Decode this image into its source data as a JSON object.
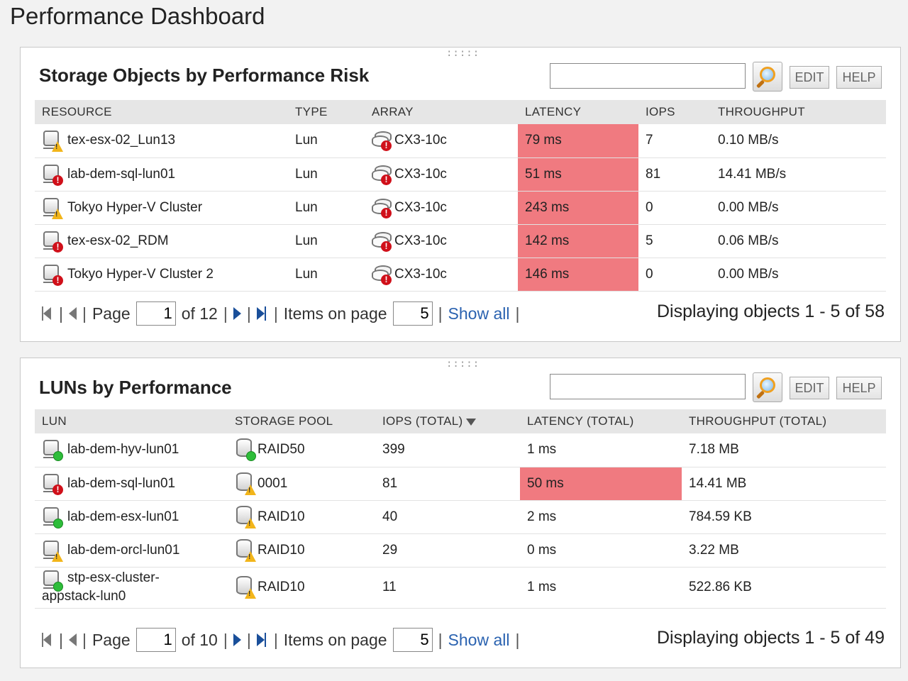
{
  "page": {
    "title": "Performance Dashboard"
  },
  "panel1": {
    "title": "Storage Objects by Performance Risk",
    "grip": ":::::",
    "search": {
      "value": "",
      "placeholder": ""
    },
    "edit_label": "EDIT",
    "help_label": "HELP",
    "columns": [
      "RESOURCE",
      "TYPE",
      "ARRAY",
      "LATENCY",
      "IOPS",
      "THROUGHPUT"
    ],
    "rows": [
      {
        "resource": "tex-esx-02_Lun13",
        "status": "warning",
        "type": "Lun",
        "array": "CX3-10c",
        "latency": "79 ms",
        "iops": "7",
        "throughput": "0.10 MB/s"
      },
      {
        "resource": "lab-dem-sql-lun01",
        "status": "critical",
        "type": "Lun",
        "array": "CX3-10c",
        "latency": "51 ms",
        "iops": "81",
        "throughput": "14.41 MB/s"
      },
      {
        "resource": "Tokyo Hyper-V Cluster",
        "status": "warning",
        "type": "Lun",
        "array": "CX3-10c",
        "latency": "243 ms",
        "iops": "0",
        "throughput": "0.00 MB/s"
      },
      {
        "resource": "tex-esx-02_RDM",
        "status": "critical",
        "type": "Lun",
        "array": "CX3-10c",
        "latency": "142 ms",
        "iops": "5",
        "throughput": "0.06 MB/s"
      },
      {
        "resource": "Tokyo Hyper-V Cluster 2",
        "status": "critical",
        "type": "Lun",
        "array": "CX3-10c",
        "latency": "146 ms",
        "iops": "0",
        "throughput": "0.00 MB/s"
      }
    ],
    "pager": {
      "page_label": "Page",
      "page_value": "1",
      "of_label": "of 12",
      "items_label": "Items on page",
      "items_value": "5",
      "show_all": "Show all",
      "display_text": "Displaying objects 1 - 5 of 58"
    }
  },
  "panel2": {
    "title": "LUNs by Performance",
    "grip": ":::::",
    "search": {
      "value": "",
      "placeholder": ""
    },
    "edit_label": "EDIT",
    "help_label": "HELP",
    "columns": [
      "LUN",
      "STORAGE POOL",
      "IOPS (TOTAL)",
      "LATENCY (TOTAL)",
      "THROUGHPUT (TOTAL)"
    ],
    "rows": [
      {
        "lun": "lab-dem-hyv-lun01",
        "status": "ok",
        "pool": "RAID50",
        "pool_status": "ok",
        "iops": "399",
        "latency": "1 ms",
        "throughput": "7.18 MB"
      },
      {
        "lun": "lab-dem-sql-lun01",
        "status": "critical",
        "pool": "0001",
        "pool_status": "warning",
        "iops": "81",
        "latency": "50 ms",
        "throughput": "14.41 MB"
      },
      {
        "lun": "lab-dem-esx-lun01",
        "status": "ok",
        "pool": "RAID10",
        "pool_status": "warning",
        "iops": "40",
        "latency": "2 ms",
        "throughput": "784.59 KB"
      },
      {
        "lun": "lab-dem-orcl-lun01",
        "status": "warning",
        "pool": "RAID10",
        "pool_status": "warning",
        "iops": "29",
        "latency": "0 ms",
        "throughput": "3.22 MB"
      },
      {
        "lun_line1": "stp-esx-cluster-",
        "lun_line2": "appstack-lun0",
        "status": "ok",
        "pool": "RAID10",
        "pool_status": "warning",
        "iops": "11",
        "latency": "1 ms",
        "throughput": "522.86 KB"
      }
    ],
    "pager": {
      "page_label": "Page",
      "page_value": "1",
      "of_label": "of 10",
      "items_label": "Items on page",
      "items_value": "5",
      "show_all": "Show all",
      "display_text": "Displaying objects 1 - 5 of 49"
    }
  },
  "colors": {
    "alert_cell": "#f07a80",
    "link": "#2a62b0",
    "critical": "#d0101a",
    "warning": "#f2b51a",
    "ok": "#2ebd3a"
  }
}
